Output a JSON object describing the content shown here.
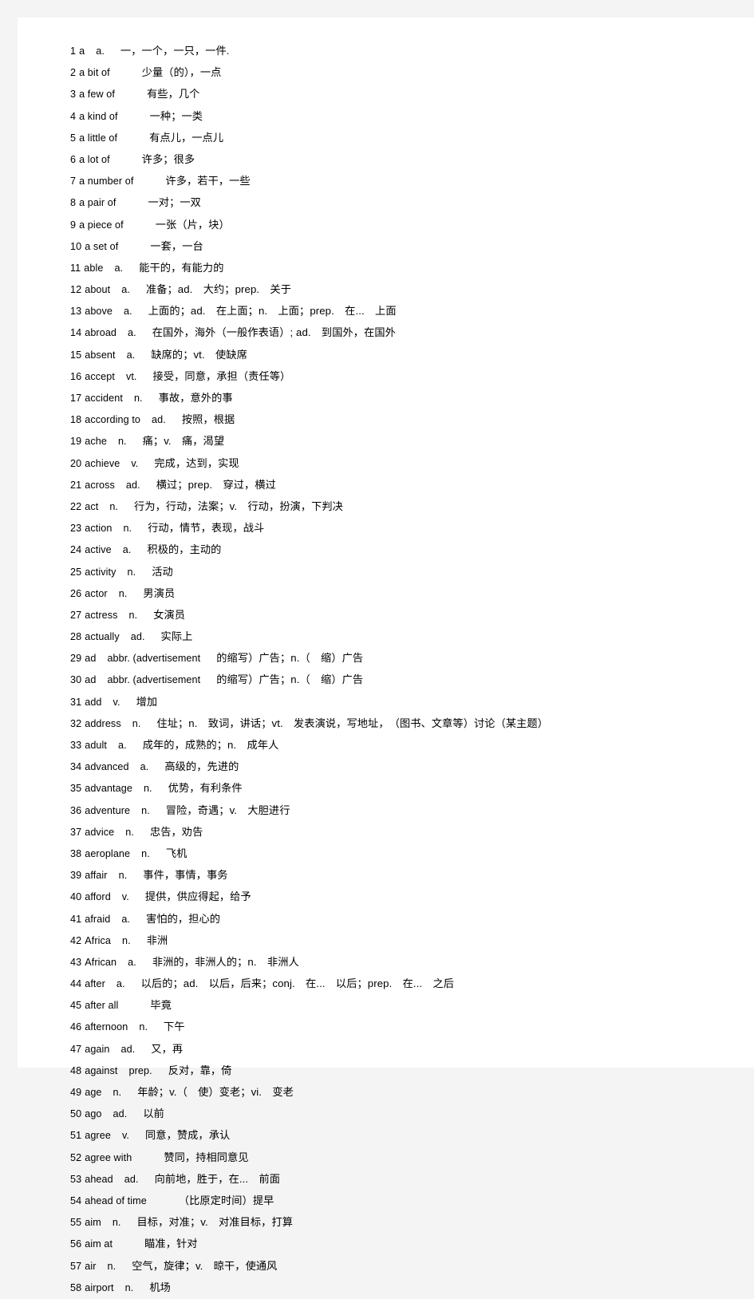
{
  "document": {
    "type": "vocabulary-word-list",
    "entries": [
      {
        "num": "1",
        "headword": "a",
        "pos": "a.",
        "definition": "一，一个，一只，一件."
      },
      {
        "num": "2",
        "headword": "a bit of",
        "pos": "",
        "definition": "少量（的），一点"
      },
      {
        "num": "3",
        "headword": "a few of",
        "pos": "",
        "definition": "有些，几个"
      },
      {
        "num": "4",
        "headword": "a kind of",
        "pos": "",
        "definition": "一种；一类"
      },
      {
        "num": "5",
        "headword": "a little of",
        "pos": "",
        "definition": "有点儿，一点儿"
      },
      {
        "num": "6",
        "headword": "a lot of",
        "pos": "",
        "definition": "许多；很多"
      },
      {
        "num": "7",
        "headword": "a number of",
        "pos": "",
        "definition": "许多，若干，一些"
      },
      {
        "num": "8",
        "headword": "a pair of",
        "pos": "",
        "definition": "一对；一双"
      },
      {
        "num": "9",
        "headword": "a piece of",
        "pos": "",
        "definition": "一张（片，块）"
      },
      {
        "num": "10",
        "headword": "a set of",
        "pos": "",
        "definition": "一套，一台"
      },
      {
        "num": "11",
        "headword": "able",
        "pos": "a.",
        "definition": "能干的，有能力的"
      },
      {
        "num": "12",
        "headword": "about",
        "pos": "a.",
        "definition": "准备；ad.　大约；prep.　关于"
      },
      {
        "num": "13",
        "headword": "above",
        "pos": "a.",
        "definition": "上面的；ad.　在上面；n.　上面；prep.　在...　上面"
      },
      {
        "num": "14",
        "headword": "abroad",
        "pos": "a.",
        "definition": "在国外，海外（一般作表语）; ad.　到国外，在国外"
      },
      {
        "num": "15",
        "headword": "absent",
        "pos": "a.",
        "definition": "缺席的；vt.　使缺席"
      },
      {
        "num": "16",
        "headword": "accept",
        "pos": "vt.",
        "definition": "接受，同意，承担（责任等）"
      },
      {
        "num": "17",
        "headword": "accident",
        "pos": "n.",
        "definition": "事故，意外的事"
      },
      {
        "num": "18",
        "headword": "according to",
        "pos": "ad.",
        "definition": "按照，根据"
      },
      {
        "num": "19",
        "headword": "ache",
        "pos": "n.",
        "definition": "痛；v.　痛，渴望"
      },
      {
        "num": "20",
        "headword": "achieve",
        "pos": "v.",
        "definition": "完成，达到，实现"
      },
      {
        "num": "21",
        "headword": "across",
        "pos": "ad.",
        "definition": "横过；prep.　穿过，横过"
      },
      {
        "num": "22",
        "headword": "act",
        "pos": "n.",
        "definition": "行为，行动，法案；v.　行动，扮演，下判决"
      },
      {
        "num": "23",
        "headword": "action",
        "pos": "n.",
        "definition": "行动，情节，表现，战斗"
      },
      {
        "num": "24",
        "headword": "active",
        "pos": "a.",
        "definition": "积极的，主动的"
      },
      {
        "num": "25",
        "headword": "activity",
        "pos": "n.",
        "definition": "活动"
      },
      {
        "num": "26",
        "headword": "actor",
        "pos": "n.",
        "definition": "男演员"
      },
      {
        "num": "27",
        "headword": "actress",
        "pos": "n.",
        "definition": "女演员"
      },
      {
        "num": "28",
        "headword": "actually",
        "pos": "ad.",
        "definition": "实际上"
      },
      {
        "num": "29",
        "headword": "ad",
        "pos": "abbr. (advertisement",
        "definition": "的缩写）广告；n.（　缩）广告"
      },
      {
        "num": "30",
        "headword": "ad",
        "pos": "abbr. (advertisement",
        "definition": "的缩写）广告；n.（　缩）广告"
      },
      {
        "num": "31",
        "headword": "add",
        "pos": "v.",
        "definition": "增加"
      },
      {
        "num": "32",
        "headword": "address",
        "pos": "n.",
        "definition": "住址；n.　致词，讲话；vt.　发表演说，写地址，　（图书、文章等）讨论（某主题）"
      },
      {
        "num": "33",
        "headword": "adult",
        "pos": "a.",
        "definition": "成年的，成熟的；n.　成年人"
      },
      {
        "num": "34",
        "headword": "advanced",
        "pos": "a.",
        "definition": "高级的，先进的"
      },
      {
        "num": "35",
        "headword": "advantage",
        "pos": "n.",
        "definition": "优势，有利条件"
      },
      {
        "num": "36",
        "headword": "adventure",
        "pos": "n.",
        "definition": "冒险，奇遇；v.　大胆进行"
      },
      {
        "num": "37",
        "headword": "advice",
        "pos": "n.",
        "definition": "忠告，劝告"
      },
      {
        "num": "38",
        "headword": "aeroplane",
        "pos": "n.",
        "definition": "飞机"
      },
      {
        "num": "39",
        "headword": "affair",
        "pos": "n.",
        "definition": "事件，事情，事务"
      },
      {
        "num": "40",
        "headword": "afford",
        "pos": "v.",
        "definition": "提供，供应得起，给予"
      },
      {
        "num": "41",
        "headword": "afraid",
        "pos": "a.",
        "definition": "害怕的，担心的"
      },
      {
        "num": "42",
        "headword": "Africa",
        "pos": "n.",
        "definition": "非洲"
      },
      {
        "num": "43",
        "headword": "African",
        "pos": "a.",
        "definition": "非洲的，非洲人的；n.　非洲人"
      },
      {
        "num": "44",
        "headword": "after",
        "pos": "a.",
        "definition": "以后的；ad.　以后，后来；conj.　在...　以后；prep.　在...　之后"
      },
      {
        "num": "45",
        "headword": "after all",
        "pos": "",
        "definition": "毕竟"
      },
      {
        "num": "46",
        "headword": "afternoon",
        "pos": "n.",
        "definition": "下午"
      },
      {
        "num": "47",
        "headword": "again",
        "pos": "ad.",
        "definition": "又，再"
      },
      {
        "num": "48",
        "headword": "against",
        "pos": "prep.",
        "definition": "反对，靠，倚"
      },
      {
        "num": "49",
        "headword": "age",
        "pos": "n.",
        "definition": "年龄；v.（　使）变老；vi.　变老"
      },
      {
        "num": "50",
        "headword": "ago",
        "pos": "ad.",
        "definition": "以前"
      },
      {
        "num": "51",
        "headword": "agree",
        "pos": "v.",
        "definition": "同意，赞成，承认"
      },
      {
        "num": "52",
        "headword": "agree with",
        "pos": "",
        "definition": "赞同，持相同意见"
      },
      {
        "num": "53",
        "headword": "ahead",
        "pos": "ad.",
        "definition": "向前地，胜于，在...　前面"
      },
      {
        "num": "54",
        "headword": "ahead of time",
        "pos": "",
        "definition": "（比原定时间）提早"
      },
      {
        "num": "55",
        "headword": "aim",
        "pos": "n.",
        "definition": "目标，对准；v.　对准目标，打算"
      },
      {
        "num": "56",
        "headword": "aim at",
        "pos": "",
        "definition": "瞄准，针对"
      },
      {
        "num": "57",
        "headword": "air",
        "pos": "n.",
        "definition": "空气，旋律；v.　晾干，使通风"
      },
      {
        "num": "58",
        "headword": "airport",
        "pos": "n.",
        "definition": "机场"
      }
    ]
  }
}
